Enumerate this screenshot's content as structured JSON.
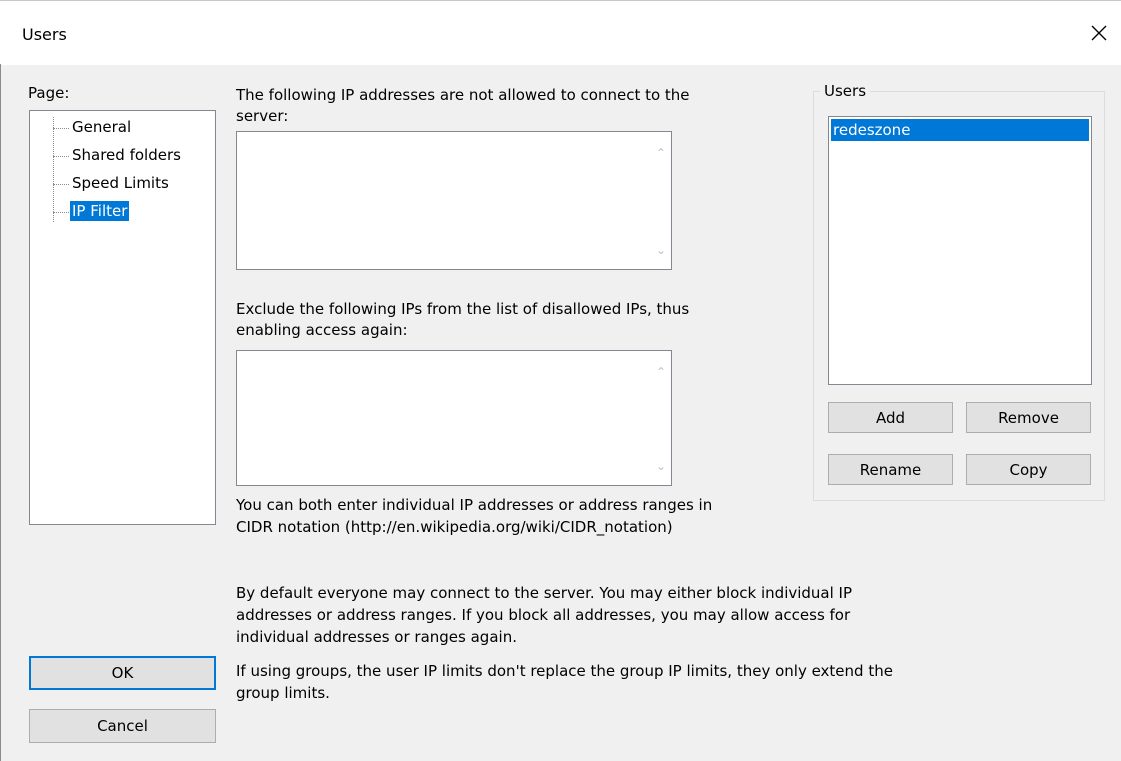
{
  "window": {
    "title": "Users",
    "close_label": "Close"
  },
  "page": {
    "label": "Page:",
    "tree": [
      {
        "label": "General",
        "selected": false
      },
      {
        "label": "Shared folders",
        "selected": false
      },
      {
        "label": "Speed Limits",
        "selected": false
      },
      {
        "label": "IP Filter",
        "selected": true
      }
    ]
  },
  "ip_filter": {
    "disallowed_label_line1": "The following IP addresses are not allowed to connect to the",
    "disallowed_label_line2": "server:",
    "disallowed_value": "",
    "exclude_label_line1": "Exclude the following IPs from the list of disallowed IPs, thus",
    "exclude_label_line2": "enabling access again:",
    "exclude_value": "",
    "hint_line1": "You can both enter individual IP addresses or address ranges in",
    "hint_line2": "CIDR notation (http://en.wikipedia.org/wiki/CIDR_notation)",
    "info_line1": "By default everyone may connect to the server. You may either block individual IP",
    "info_line2": "addresses or address ranges. If you block all addresses, you may allow access for",
    "info_line3": "individual addresses or ranges again.",
    "groups_line1": "If using groups, the user IP limits don't replace the group IP limits, they only extend the",
    "groups_line2": "group limits."
  },
  "users_panel": {
    "title": "Users",
    "users": [
      "redeszone"
    ],
    "selected_user": "redeszone",
    "add_label": "Add",
    "remove_label": "Remove",
    "rename_label": "Rename",
    "copy_label": "Copy"
  },
  "footer": {
    "ok_label": "OK",
    "cancel_label": "Cancel"
  },
  "colors": {
    "selection": "#0078d7",
    "background": "#f0f0f0",
    "button": "#e1e1e1"
  }
}
